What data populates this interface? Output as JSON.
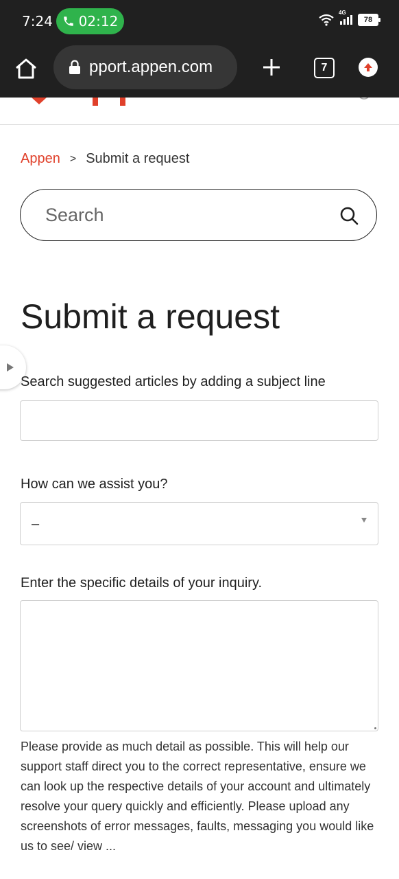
{
  "status_bar": {
    "time": "7:24",
    "call_timer": "02:12",
    "network": "4G",
    "battery": "78"
  },
  "browser": {
    "url": "pport.appen.com",
    "tab_count": "7"
  },
  "breadcrumb": {
    "home": "Appen",
    "separator": ">",
    "current": "Submit a request"
  },
  "search": {
    "placeholder": "Search"
  },
  "page_title": "Submit a request",
  "form": {
    "subject_label": "Search suggested articles by adding a subject line",
    "subject_value": "",
    "assist_label": "How can we assist you?",
    "assist_selected": "–",
    "details_label": "Enter the specific details of your inquiry.",
    "details_value": "",
    "details_help": "Please provide as much detail as possible. This will help our support staff direct you to the correct representative, ensure we can look up the respective details of your account and ultimately resolve your query quickly and efficiently. Please upload any screenshots of error messages, faults, messaging you would like us to see/ view ..."
  },
  "colors": {
    "brand": "#e0402a",
    "chrome": "#202020",
    "call_green": "#2fb34c"
  },
  "icons": [
    "phone-icon",
    "wifi-icon",
    "signal-icon",
    "battery-icon",
    "home-icon",
    "lock-icon",
    "plus-icon",
    "tabs-icon",
    "update-arrow-icon",
    "search-icon",
    "expand-arrow-icon",
    "chevron-down-icon"
  ]
}
